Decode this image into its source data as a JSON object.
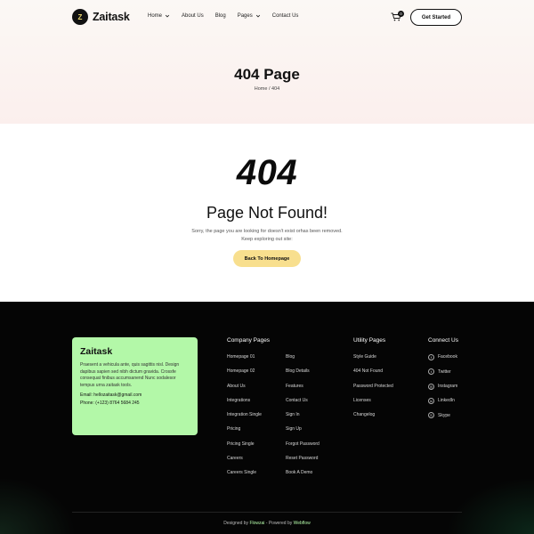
{
  "header": {
    "logo_text": "Zaitask",
    "logo_mark": "Z",
    "nav": [
      {
        "label": "Home",
        "has_dropdown": true
      },
      {
        "label": "About Us",
        "has_dropdown": false
      },
      {
        "label": "Blog",
        "has_dropdown": false
      },
      {
        "label": "Pages",
        "has_dropdown": true
      },
      {
        "label": "Contact Us",
        "has_dropdown": false
      }
    ],
    "cart_count": "0",
    "cta_label": "Get Started"
  },
  "hero": {
    "title": "404 Page",
    "breadcrumb_home": "Home",
    "breadcrumb_sep": " / ",
    "breadcrumb_current": "404"
  },
  "error": {
    "code": "404",
    "title": "Page Not Found!",
    "desc_line1": "Sorry, the page you are looking for doesn't exist orhas been removed.",
    "desc_line2": "Keep exploring out site:",
    "button_label": "Back To Homepage"
  },
  "footer": {
    "card": {
      "title": "Zaitask",
      "text": "Praesent a vehicula ante, quis sagittis nisl. Design dapibus sapien sed nibh dictum gravida. Crossfe consequat finibus accumsanend Nunc sodalesor tempus urna zaitask tools.",
      "email": "Email: hellozaitask@gmail.com",
      "phone": "Phone: (+123) 8764 5684 245"
    },
    "company_title": "Company Pages",
    "company_col1": [
      "Homepage 01",
      "Homepage 02",
      "About Us",
      "Integrations",
      "Integration Single",
      "Pricing",
      "Pricing Single",
      "Careers",
      "Careers Single"
    ],
    "company_col2": [
      "Blog",
      "Blog Details",
      "Features",
      "Contact Us",
      "Sign In",
      "Sign Up",
      "Forgot Password",
      "Reset Password",
      "Book A Demo"
    ],
    "utility_title": "Utility Pages",
    "utility": [
      "Style Guide",
      "404 Not Found",
      "Password Protected",
      "Licenses",
      "Changelog"
    ],
    "connect_title": "Connect Us",
    "connect": [
      {
        "label": "Facebook",
        "icon": "facebook-icon",
        "glyph": "f"
      },
      {
        "label": "Twitter",
        "icon": "twitter-icon",
        "glyph": "t"
      },
      {
        "label": "Instagram",
        "icon": "instagram-icon",
        "glyph": "◎"
      },
      {
        "label": "LinkedIn",
        "icon": "linkedin-icon",
        "glyph": "in"
      },
      {
        "label": "Skype",
        "icon": "skype-icon",
        "glyph": "S"
      }
    ],
    "credits_prefix": "Designed by ",
    "credits_designer": "Flowzai",
    "credits_mid": " - Powered by ",
    "credits_platform": "Webflow"
  },
  "colors": {
    "accent_green": "#b3f8a8",
    "accent_yellow": "#f8df8e",
    "footer_bg": "#050505"
  }
}
